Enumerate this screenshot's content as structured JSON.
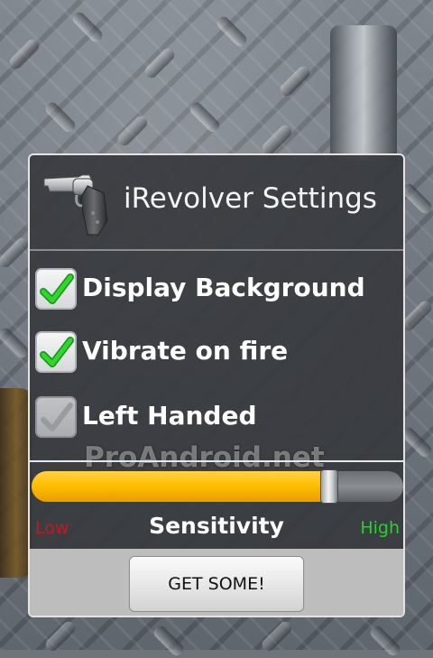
{
  "background": {
    "theme": "diamond-plate-metal",
    "base_color": "#707780"
  },
  "dialog": {
    "title": "iRevolver Settings",
    "icon": "revolver-icon",
    "settings": [
      {
        "label": "Display Background",
        "checked": true,
        "enabled": true
      },
      {
        "label": "Vibrate on fire",
        "checked": true,
        "enabled": true
      },
      {
        "label": "Left Handed",
        "checked": false,
        "enabled": false
      }
    ],
    "slider": {
      "label": "Sensitivity",
      "low_label": "Low",
      "high_label": "High",
      "value_fraction": 0.8,
      "fill_color": "#ffbf00"
    },
    "button_label": "GET SOME!"
  },
  "watermark": "ProAndroid.net",
  "colors": {
    "check_green": "#22c021",
    "low_red": "#c41a1a",
    "high_green": "#28d22a"
  }
}
